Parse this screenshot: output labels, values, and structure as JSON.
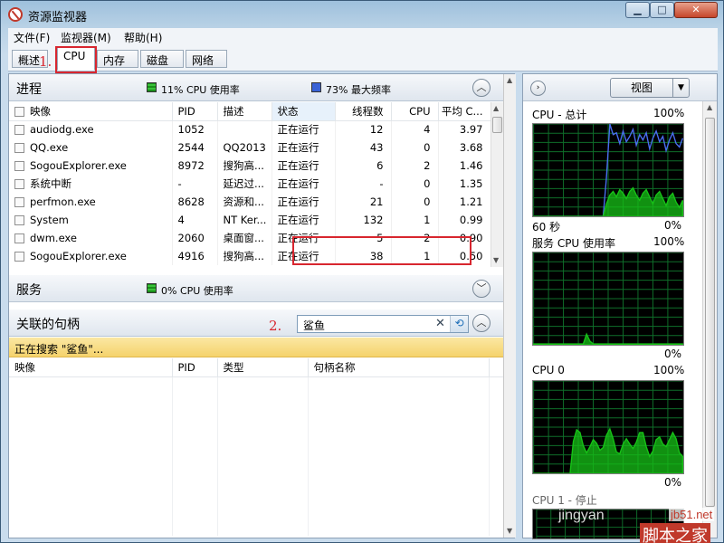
{
  "window": {
    "title": "资源监视器",
    "min": "▁",
    "max": "□",
    "close": "✕"
  },
  "menu": [
    "文件(F)",
    "监视器(M)",
    "帮助(H)"
  ],
  "tabs": [
    "概述",
    "CPU",
    "内存",
    "磁盘",
    "网络"
  ],
  "annotations": {
    "step1": "1.",
    "step2": "2."
  },
  "processes": {
    "title": "进程",
    "cpu_stat": "11% CPU 使用率",
    "freq_stat": "73% 最大频率",
    "columns": [
      "映像",
      "PID",
      "描述",
      "状态",
      "线程数",
      "CPU",
      "平均 C..."
    ],
    "rows": [
      [
        "audiodg.exe",
        "1052",
        "",
        "正在运行",
        "12",
        "4",
        "3.97"
      ],
      [
        "QQ.exe",
        "2544",
        "QQ2013",
        "正在运行",
        "43",
        "0",
        "3.68"
      ],
      [
        "SogouExplorer.exe",
        "8972",
        "搜狗高...",
        "正在运行",
        "6",
        "2",
        "1.46"
      ],
      [
        "系统中断",
        "-",
        "延迟过...",
        "正在运行",
        "-",
        "0",
        "1.35"
      ],
      [
        "perfmon.exe",
        "8628",
        "资源和...",
        "正在运行",
        "21",
        "0",
        "1.21"
      ],
      [
        "System",
        "4",
        "NT Ker...",
        "正在运行",
        "132",
        "1",
        "0.99"
      ],
      [
        "dwm.exe",
        "2060",
        "桌面窗...",
        "正在运行",
        "5",
        "2",
        "0.90"
      ],
      [
        "SogouExplorer.exe",
        "4916",
        "搜狗高...",
        "正在运行",
        "38",
        "1",
        "0.50"
      ]
    ]
  },
  "services": {
    "title": "服务",
    "cpu_stat": "0% CPU 使用率"
  },
  "handles": {
    "title": "关联的句柄",
    "search_value": "鲨鱼",
    "status": "正在搜索 \"鲨鱼\"...",
    "columns": [
      "映像",
      "PID",
      "类型",
      "句柄名称"
    ]
  },
  "right": {
    "view_label": "视图",
    "graphs": [
      {
        "title": "CPU - 总计",
        "top": "100%",
        "bottom_left": "60 秒",
        "bottom_right": "0%"
      },
      {
        "title": "服务 CPU 使用率",
        "top": "100%",
        "bottom_left": "",
        "bottom_right": "0%"
      },
      {
        "title": "CPU 0",
        "top": "100%",
        "bottom_left": "",
        "bottom_right": "0%"
      },
      {
        "title": "CPU 1 - 停止",
        "top": "",
        "bottom_left": "",
        "bottom_right": ""
      }
    ]
  },
  "watermarks": {
    "site": "jb51.net",
    "brand": "脚本之家",
    "jy": "jingyan"
  },
  "colors": {
    "accent_red": "#d8262f",
    "graph_green": "#17c217",
    "graph_blue": "#4a6df0",
    "status_yellow": "#f5d36c"
  }
}
